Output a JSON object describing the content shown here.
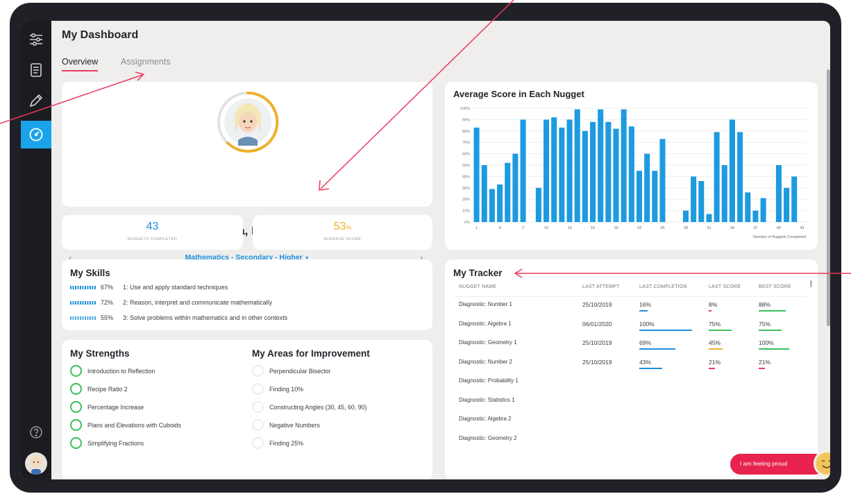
{
  "page": {
    "title": "My Dashboard"
  },
  "tabs": [
    {
      "label": "Overview",
      "active": true
    },
    {
      "label": "Assignments",
      "active": false
    }
  ],
  "sidebar": {
    "items": [
      {
        "icon": "sliders-icon"
      },
      {
        "icon": "document-icon"
      },
      {
        "icon": "pen-icon"
      },
      {
        "icon": "gauge-icon",
        "active": true
      }
    ],
    "help_icon": "help-icon",
    "avatar": "avatar"
  },
  "profile": {
    "name": "Amara, Pavan",
    "subject": "Mathematics - Secondary - Higher",
    "prev": "‹",
    "next": "›"
  },
  "stats": [
    {
      "value": "43",
      "label": "NUGGETS COMPLETED",
      "color": "#1d8fdb"
    },
    {
      "value": "53",
      "unit": "%",
      "label": "AVERAGE SCORE",
      "color": "#f0b02a"
    }
  ],
  "skills": {
    "title": "My Skills",
    "items": [
      {
        "pct": "67%",
        "text": "1: Use and apply standard techniques"
      },
      {
        "pct": "72%",
        "text": "2: Reason, interpret and communicate mathematically"
      },
      {
        "pct": "55%",
        "text": "3: Solve problems within mathematics and in other contexts"
      }
    ]
  },
  "strengths": {
    "title": "My Strengths",
    "items": [
      "Introduction to Reflection",
      "Recipe Ratio 2",
      "Percentage Increase",
      "Plans and Elevations with Cuboids",
      "Simplifying Fractions"
    ]
  },
  "improvements": {
    "title": "My Areas for Improvement",
    "items": [
      "Perpendicular Bisector",
      "Finding 10%",
      "Constructing Angles (30, 45, 60, 90)",
      "Negative Numbers",
      "Finding 25%"
    ]
  },
  "tracker": {
    "title": "My Tracker",
    "headers": [
      "NUGGET NAME",
      "LAST ATTEMPT",
      "LAST COMPLETION",
      "LAST SCORE",
      "BEST SCORE"
    ],
    "rows": [
      {
        "name": "Diagnostic: Number 1",
        "attempt": "25/10/2019",
        "completion": "16%",
        "completion_value": 16,
        "last": "8%",
        "last_value": 8,
        "best": "88%",
        "best_value": 88
      },
      {
        "name": "Diagnostic: Algebra 1",
        "attempt": "06/01/2020",
        "completion": "100%",
        "completion_value": 100,
        "last": "75%",
        "last_value": 75,
        "best": "75%",
        "best_value": 75
      },
      {
        "name": "Diagnostic: Geometry 1",
        "attempt": "25/10/2019",
        "completion": "69%",
        "completion_value": 69,
        "last": "45%",
        "last_value": 45,
        "best": "100%",
        "best_value": 100
      },
      {
        "name": "Diagnostic: Number 2",
        "attempt": "25/10/2019",
        "completion": "43%",
        "completion_value": 43,
        "last": "21%",
        "last_value": 21,
        "best": "21%",
        "best_value": 21
      },
      {
        "name": "Diagnostic: Probability 1",
        "attempt": "",
        "completion": "",
        "last": "",
        "best": ""
      },
      {
        "name": "Diagnostic: Statistics 1",
        "attempt": "",
        "completion": "",
        "last": "",
        "best": ""
      },
      {
        "name": "Diagnostic: Algebra 2",
        "attempt": "",
        "completion": "",
        "last": "",
        "best": ""
      },
      {
        "name": "Diagnostic: Geometry 2",
        "attempt": "",
        "completion": "",
        "last": "",
        "best": ""
      }
    ]
  },
  "feeling": {
    "label": "I am feeling proud",
    "icon": "smiley-icon"
  },
  "colors": {
    "accent": "#1d8fdb",
    "brand_red": "#e9395e",
    "green": "#3cbf5c",
    "orange": "#f0b02a",
    "sidebar": "#1b1c21"
  },
  "chart_data": {
    "type": "bar",
    "title": "Average Score in Each Nugget",
    "xlabel": "Number of Nuggets Completed",
    "ylabel": "",
    "ylim": [
      0,
      100
    ],
    "yticks": [
      "0%",
      "10%",
      "20%",
      "30%",
      "40%",
      "50%",
      "60%",
      "70%",
      "80%",
      "90%",
      "100%"
    ],
    "xticks": [
      1,
      4,
      7,
      10,
      13,
      16,
      19,
      22,
      25,
      28,
      31,
      34,
      37,
      40,
      43
    ],
    "x": [
      1,
      2,
      3,
      4,
      5,
      6,
      7,
      8,
      9,
      10,
      11,
      12,
      13,
      14,
      15,
      16,
      17,
      18,
      19,
      20,
      21,
      22,
      23,
      24,
      25,
      26,
      27,
      28,
      29,
      30,
      31,
      32,
      33,
      34,
      35,
      36,
      37,
      38,
      39,
      40,
      41,
      42,
      43
    ],
    "values": [
      83,
      50,
      29,
      33,
      52,
      60,
      90,
      0,
      30,
      90,
      92,
      83,
      90,
      99,
      80,
      88,
      99,
      88,
      82,
      99,
      84,
      45,
      60,
      45,
      73,
      0,
      0,
      10,
      40,
      36,
      7,
      79,
      50,
      90,
      79,
      26,
      10,
      21,
      0,
      50,
      30,
      40,
      0
    ],
    "color": "#1d9ae0",
    "grid": true
  }
}
